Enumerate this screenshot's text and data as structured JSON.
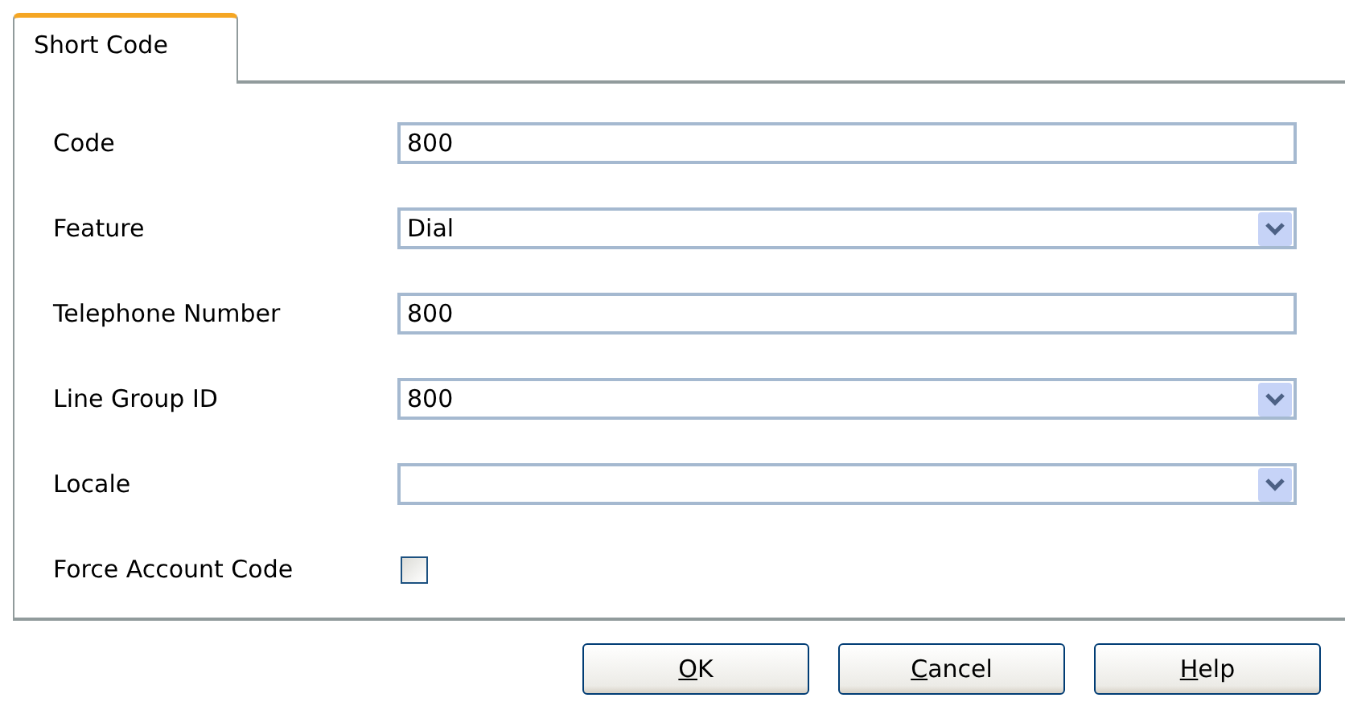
{
  "tabs": [
    {
      "label": "Short Code",
      "selected": true
    }
  ],
  "fields": [
    {
      "kind": "text",
      "label": "Code",
      "value": "800"
    },
    {
      "kind": "select",
      "label": "Feature",
      "value": "Dial"
    },
    {
      "kind": "text",
      "label": "Telephone Number",
      "value": "800"
    },
    {
      "kind": "select",
      "label": "Line Group ID",
      "value": "800"
    },
    {
      "kind": "select",
      "label": "Locale"
    },
    {
      "kind": "checkbox",
      "label": "Force Account Code",
      "checked": false
    }
  ],
  "buttons": [
    "OK",
    "Cancel",
    "Help"
  ]
}
